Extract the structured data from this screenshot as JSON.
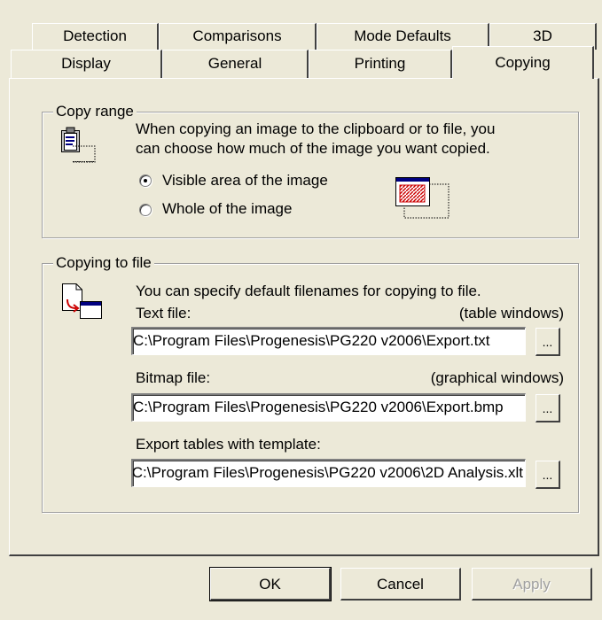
{
  "tabs": {
    "row1": [
      "Detection",
      "Comparisons",
      "Mode Defaults",
      "3D"
    ],
    "row2": [
      "Display",
      "General",
      "Printing",
      "Copying"
    ],
    "active": "Copying"
  },
  "copy_range": {
    "title": "Copy range",
    "description_line1": "When copying an image to the clipboard or to file, you",
    "description_line2": "can choose how much of the image you want copied.",
    "options": [
      {
        "label": "Visible area of the image",
        "selected": true
      },
      {
        "label": "Whole of the image",
        "selected": false
      }
    ],
    "icon": "clipboard-icon",
    "preview_icon": "image-area-icon"
  },
  "copying_to_file": {
    "title": "Copying to file",
    "description": "You can specify default filenames for copying to file.",
    "icon": "file-export-icon",
    "text_file": {
      "label": "Text file:",
      "hint": "(table windows)",
      "value": "C:\\Program Files\\Progenesis\\PG220 v2006\\Export.txt"
    },
    "bitmap_file": {
      "label": "Bitmap file:",
      "hint": "(graphical windows)",
      "value": "C:\\Program Files\\Progenesis\\PG220 v2006\\Export.bmp"
    },
    "template_file": {
      "label": "Export tables with template:",
      "value": "C:\\Program Files\\Progenesis\\PG220 v2006\\2D Analysis.xlt"
    },
    "browse_label": "..."
  },
  "buttons": {
    "ok": "OK",
    "cancel": "Cancel",
    "apply": "Apply"
  }
}
